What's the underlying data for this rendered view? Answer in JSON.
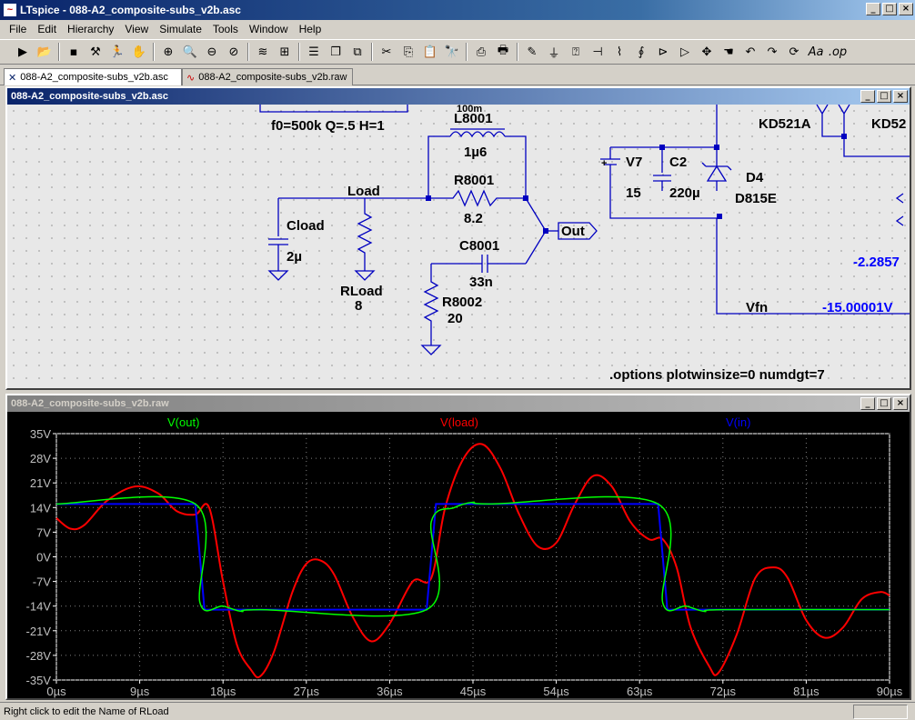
{
  "app": {
    "title": "LTspice - 088-A2_composite-subs_v2b.asc"
  },
  "menu": [
    "File",
    "Edit",
    "Hierarchy",
    "View",
    "Simulate",
    "Tools",
    "Window",
    "Help"
  ],
  "toolbar": [
    "new-icon",
    "open-icon",
    "save-icon",
    "hammer-icon",
    "run-icon",
    "pan-icon",
    "zoom-in-icon",
    "zoom-area-icon",
    "zoom-out-icon",
    "zoom-cancel-icon",
    "autorange-icon",
    "grid-icon",
    "tile-h-icon",
    "cascade-icon",
    "tile-v-icon",
    "cut-icon",
    "copy-icon",
    "paste-icon",
    "find-icon",
    "print-preview-icon",
    "print-icon",
    "pencil-icon",
    "wire-icon",
    "ground-icon",
    "label-icon",
    "resistor-icon",
    "capacitor-icon",
    "inductor-icon",
    "diode-icon",
    "component-icon",
    "move-icon",
    "drag-icon",
    "undo-icon",
    "redo-icon",
    "rotate-icon",
    "text-icon",
    "spice-directive-icon"
  ],
  "tabs": [
    {
      "label": "088-A2_composite-subs_v2b.asc",
      "icon": "schematic-icon"
    },
    {
      "label": "088-A2_composite-subs_v2b.raw",
      "icon": "waveform-icon"
    }
  ],
  "schematic": {
    "title": "088-A2_composite-subs_v2b.asc",
    "filter_text": "f0=500k Q=.5 H=1",
    "truncated_top": "100m",
    "L8001": {
      "name": "L8001",
      "value": "1µ6"
    },
    "R8001": {
      "name": "R8001",
      "value": "8.2"
    },
    "C8001": {
      "name": "C8001",
      "value": "33n"
    },
    "R8002": {
      "name": "R8002",
      "value": "20"
    },
    "Cload": {
      "name": "Cload",
      "value": "2µ"
    },
    "RLoad": {
      "name": "RLoad",
      "value": "8"
    },
    "V7": {
      "name": "V7",
      "value": "15"
    },
    "C2": {
      "name": "C2",
      "value": "220µ"
    },
    "D4": {
      "name": "D4",
      "value": "D815E"
    },
    "KD1": "KD521A",
    "KD2": "KD52",
    "net_load": "Load",
    "net_out": "Out",
    "net_vfn": "Vfn",
    "readout1": "-2.2857",
    "readout2": "-15.00001V",
    "directive": ".options plotwinsize=0 numdgt=7"
  },
  "waveform": {
    "title": "088-A2_composite-subs_v2b.raw",
    "colors": {
      "out": "#00ff00",
      "load": "#ff0000",
      "in": "#0000ff"
    }
  },
  "chart_data": {
    "type": "line",
    "series": [
      {
        "name": "V(out)",
        "color": "#00ff00"
      },
      {
        "name": "V(load)",
        "color": "#ff0000"
      },
      {
        "name": "V(in)",
        "color": "#0000ff"
      }
    ],
    "x_ticks": [
      "0µs",
      "9µs",
      "18µs",
      "27µs",
      "36µs",
      "45µs",
      "54µs",
      "63µs",
      "72µs",
      "81µs",
      "90µs"
    ],
    "y_ticks": [
      "35V",
      "28V",
      "21V",
      "14V",
      "7V",
      "0V",
      "-7V",
      "-14V",
      "-21V",
      "-28V",
      "-35V"
    ],
    "xlim": [
      0,
      90
    ],
    "ylim": [
      -35,
      35
    ],
    "x_unit": "µs",
    "grid": true,
    "vin": [
      [
        0,
        15
      ],
      [
        15,
        15
      ],
      [
        16,
        -15
      ],
      [
        40,
        -15
      ],
      [
        41,
        15
      ],
      [
        65,
        15
      ],
      [
        66,
        -15
      ],
      [
        90,
        -15
      ]
    ],
    "vout": [
      [
        0,
        15
      ],
      [
        15,
        15
      ],
      [
        15.5,
        -13
      ],
      [
        18,
        -14
      ],
      [
        20,
        -15.5
      ],
      [
        22,
        -15
      ],
      [
        40,
        -15
      ],
      [
        40.5,
        10
      ],
      [
        43,
        14
      ],
      [
        45,
        15.5
      ],
      [
        47,
        15
      ],
      [
        65,
        15
      ],
      [
        65.5,
        -13
      ],
      [
        68,
        -14
      ],
      [
        70,
        -15.5
      ],
      [
        72,
        -15
      ],
      [
        90,
        -15
      ]
    ],
    "vload": [
      [
        0,
        11
      ],
      [
        1.5,
        8
      ],
      [
        3,
        9
      ],
      [
        5.5,
        16
      ],
      [
        8.5,
        20
      ],
      [
        11,
        18
      ],
      [
        13,
        13
      ],
      [
        15,
        12
      ],
      [
        16.5,
        14
      ],
      [
        18,
        -7
      ],
      [
        19.5,
        -25
      ],
      [
        21,
        -32
      ],
      [
        22,
        -34
      ],
      [
        23.5,
        -27
      ],
      [
        25.5,
        -10
      ],
      [
        27,
        -2
      ],
      [
        28.5,
        -1
      ],
      [
        30,
        -5
      ],
      [
        32,
        -17
      ],
      [
        34,
        -24
      ],
      [
        36,
        -19
      ],
      [
        38.5,
        -7
      ],
      [
        40.5,
        -6
      ],
      [
        42,
        14
      ],
      [
        44,
        28
      ],
      [
        46,
        32
      ],
      [
        48,
        25
      ],
      [
        50,
        12
      ],
      [
        52,
        3
      ],
      [
        54,
        4
      ],
      [
        56,
        15
      ],
      [
        58,
        23
      ],
      [
        60,
        20
      ],
      [
        62,
        10
      ],
      [
        64,
        5
      ],
      [
        65.5,
        5
      ],
      [
        67,
        -3
      ],
      [
        68.5,
        -20
      ],
      [
        70.5,
        -31
      ],
      [
        71.5,
        -33
      ],
      [
        73.5,
        -22
      ],
      [
        75.5,
        -6
      ],
      [
        77.5,
        -3
      ],
      [
        79,
        -6
      ],
      [
        81,
        -18
      ],
      [
        83,
        -23
      ],
      [
        85,
        -20
      ],
      [
        87,
        -12
      ],
      [
        89,
        -10
      ],
      [
        90,
        -11
      ]
    ]
  },
  "status": {
    "text": "Right click to edit the Name of RLoad"
  }
}
